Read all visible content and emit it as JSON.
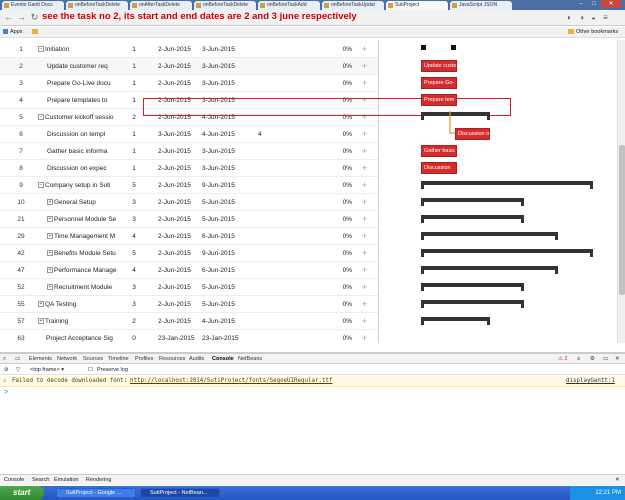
{
  "browser": {
    "tabs": [
      {
        "label": "Events Gantt Docs"
      },
      {
        "label": "onBeforeTaskDelete"
      },
      {
        "label": "onAfterTaskDelete"
      },
      {
        "label": "onBeforeTaskDelete"
      },
      {
        "label": "onBeforeTaskAdd"
      },
      {
        "label": "onBeforeTaskUpdat"
      },
      {
        "label": "SutiProject"
      },
      {
        "label": "JavaScript JSON"
      }
    ],
    "caption": "see the task no 2, its start and end dates are 2 and 3 june respectively",
    "bookmarks": {
      "apps": "Apps",
      "other": "Other bookmarks"
    }
  },
  "tasks": [
    {
      "num": "1",
      "name": "Initiation",
      "toggle": "−",
      "indent": 0,
      "duration": "1",
      "start": "2-Jun-2015",
      "end": "3-Jun-2015",
      "pred": "",
      "progress": "0%"
    },
    {
      "num": "2",
      "name": "Update customer req",
      "toggle": "",
      "indent": 1,
      "duration": "1",
      "start": "2-Jun-2015",
      "end": "3-Jun-2015",
      "pred": "",
      "progress": "0%"
    },
    {
      "num": "3",
      "name": "Prepare Go-Live docu",
      "toggle": "",
      "indent": 1,
      "duration": "1",
      "start": "2-Jun-2015",
      "end": "3-Jun-2015",
      "pred": "",
      "progress": "0%"
    },
    {
      "num": "4",
      "name": "Prepare templates to",
      "toggle": "",
      "indent": 1,
      "duration": "1",
      "start": "2-Jun-2015",
      "end": "3-Jun-2015",
      "pred": "",
      "progress": "0%"
    },
    {
      "num": "5",
      "name": "Customer kickoff sessio",
      "toggle": "−",
      "indent": 0,
      "duration": "2",
      "start": "2-Jun-2015",
      "end": "4-Jun-2015",
      "pred": "",
      "progress": "0%"
    },
    {
      "num": "6",
      "name": "Discussion on templ",
      "toggle": "",
      "indent": 1,
      "duration": "1",
      "start": "3-Jun-2015",
      "end": "4-Jun-2015",
      "pred": "4",
      "progress": "0%"
    },
    {
      "num": "7",
      "name": "Gather basic informa",
      "toggle": "",
      "indent": 1,
      "duration": "1",
      "start": "2-Jun-2015",
      "end": "3-Jun-2015",
      "pred": "",
      "progress": "0%"
    },
    {
      "num": "8",
      "name": "Discussion on expec",
      "toggle": "",
      "indent": 1,
      "duration": "1",
      "start": "2-Jun-2015",
      "end": "3-Jun-2015",
      "pred": "",
      "progress": "0%"
    },
    {
      "num": "9",
      "name": "Company setup in Suti",
      "toggle": "−",
      "indent": 0,
      "duration": "5",
      "start": "2-Jun-2015",
      "end": "9-Jun-2015",
      "pred": "",
      "progress": "0%"
    },
    {
      "num": "10",
      "name": "General Setup",
      "toggle": "+",
      "indent": 1,
      "duration": "3",
      "start": "2-Jun-2015",
      "end": "5-Jun-2015",
      "pred": "",
      "progress": "0%"
    },
    {
      "num": "21",
      "name": "Personnel Module Se",
      "toggle": "+",
      "indent": 1,
      "duration": "3",
      "start": "2-Jun-2015",
      "end": "5-Jun-2015",
      "pred": "",
      "progress": "0%"
    },
    {
      "num": "29",
      "name": "Time Management M",
      "toggle": "+",
      "indent": 1,
      "duration": "4",
      "start": "2-Jun-2015",
      "end": "6-Jun-2015",
      "pred": "",
      "progress": "0%"
    },
    {
      "num": "42",
      "name": "Benefits Module Setu",
      "toggle": "+",
      "indent": 1,
      "duration": "5",
      "start": "2-Jun-2015",
      "end": "9-Jun-2015",
      "pred": "",
      "progress": "0%"
    },
    {
      "num": "47",
      "name": "Performance Manage",
      "toggle": "+",
      "indent": 1,
      "duration": "4",
      "start": "2-Jun-2015",
      "end": "6-Jun-2015",
      "pred": "",
      "progress": "0%"
    },
    {
      "num": "52",
      "name": "Recruitment Module",
      "toggle": "+",
      "indent": 1,
      "duration": "3",
      "start": "2-Jun-2015",
      "end": "5-Jun-2015",
      "pred": "",
      "progress": "0%"
    },
    {
      "num": "55",
      "name": "QA Testing",
      "toggle": "+",
      "indent": 0,
      "duration": "3",
      "start": "2-Jun-2015",
      "end": "5-Jun-2015",
      "pred": "",
      "progress": "0%"
    },
    {
      "num": "57",
      "name": "Training",
      "toggle": "+",
      "indent": 0,
      "duration": "2",
      "start": "2-Jun-2015",
      "end": "4-Jun-2015",
      "pred": "",
      "progress": "0%"
    },
    {
      "num": "63",
      "name": "Project Acceptance Sig",
      "toggle": "",
      "indent": 0,
      "duration": "0",
      "start": "23-Jan-2015",
      "end": "23-Jan-2015",
      "pred": "",
      "progress": "0%"
    }
  ],
  "bars": {
    "t2": "Update custo",
    "t3": "Prepare Go-",
    "t4": "Prepare tem",
    "t6": "Discussion o",
    "t7": "Gather basic",
    "t8": "Discussion"
  },
  "devtools": {
    "tabs": [
      "Elements",
      "Network",
      "Sources",
      "Timeline",
      "Profiles",
      "Resources",
      "Audits",
      "Console",
      "NetBeans"
    ],
    "frame": "<top frame>",
    "preserve_log": "Preserve log",
    "message_prefix": "Failed to decode downloaded font:",
    "message_url": "http://localhost:2014/SutiProject/fonts/SegoeUIRegular.ttf",
    "message_source": "displayGantt:1",
    "error_count": "2",
    "prompt": ">",
    "drawer_tabs": [
      "Console",
      "Search",
      "Emulation",
      "Rendering"
    ]
  },
  "taskbar": {
    "start": "start",
    "items": [
      "SutiProject - Google ...",
      "SutiProject - NetBean..."
    ],
    "clock": "12:21 PM"
  }
}
